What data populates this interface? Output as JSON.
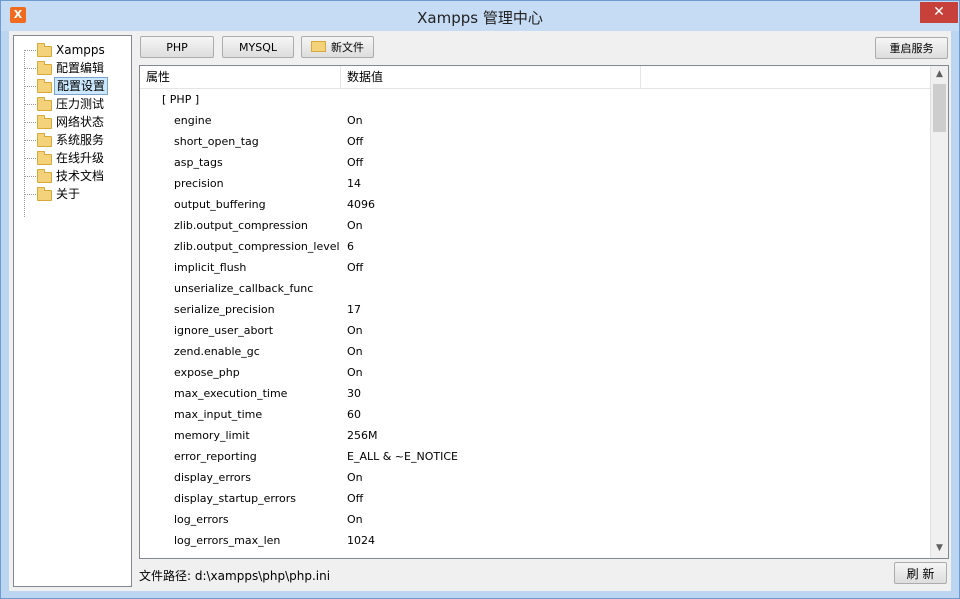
{
  "window": {
    "title": "Xampps 管理中心",
    "close_label": "✕",
    "app_icon": "X"
  },
  "tree": {
    "items": [
      {
        "label": "Xampps",
        "selected": false
      },
      {
        "label": "配置编辑",
        "selected": false
      },
      {
        "label": "配置设置",
        "selected": true
      },
      {
        "label": "压力测试",
        "selected": false
      },
      {
        "label": "网络状态",
        "selected": false
      },
      {
        "label": "系统服务",
        "selected": false
      },
      {
        "label": "在线升级",
        "selected": false
      },
      {
        "label": "技术文档",
        "selected": false
      },
      {
        "label": "关于",
        "selected": false
      }
    ]
  },
  "toolbar": {
    "php_label": "PHP",
    "mysql_label": "MYSQL",
    "newfile_label": "新文件",
    "restart_label": "重启服务"
  },
  "table": {
    "headers": [
      "属性",
      "数据值"
    ],
    "section": "[ PHP ]",
    "rows": [
      [
        "engine",
        "On"
      ],
      [
        "short_open_tag",
        "Off"
      ],
      [
        "asp_tags",
        "Off"
      ],
      [
        "precision",
        "14"
      ],
      [
        "output_buffering",
        "4096"
      ],
      [
        "zlib.output_compression",
        "On"
      ],
      [
        "zlib.output_compression_level",
        "6"
      ],
      [
        "implicit_flush",
        "Off"
      ],
      [
        "unserialize_callback_func",
        ""
      ],
      [
        "serialize_precision",
        "17"
      ],
      [
        "ignore_user_abort",
        "On"
      ],
      [
        "zend.enable_gc",
        "On"
      ],
      [
        "expose_php",
        "On"
      ],
      [
        "max_execution_time",
        "30"
      ],
      [
        "max_input_time",
        "60"
      ],
      [
        "memory_limit",
        "256M"
      ],
      [
        "error_reporting",
        "E_ALL & ~E_NOTICE"
      ],
      [
        "display_errors",
        "On"
      ],
      [
        "display_startup_errors",
        "Off"
      ],
      [
        "log_errors",
        "On"
      ],
      [
        "log_errors_max_len",
        "1024"
      ]
    ]
  },
  "footer": {
    "path_text": "文件路径: d:\\xampps\\php\\php.ini",
    "refresh_label": "刷 新"
  },
  "scrollbar": {
    "up": "▲",
    "down": "▼"
  }
}
